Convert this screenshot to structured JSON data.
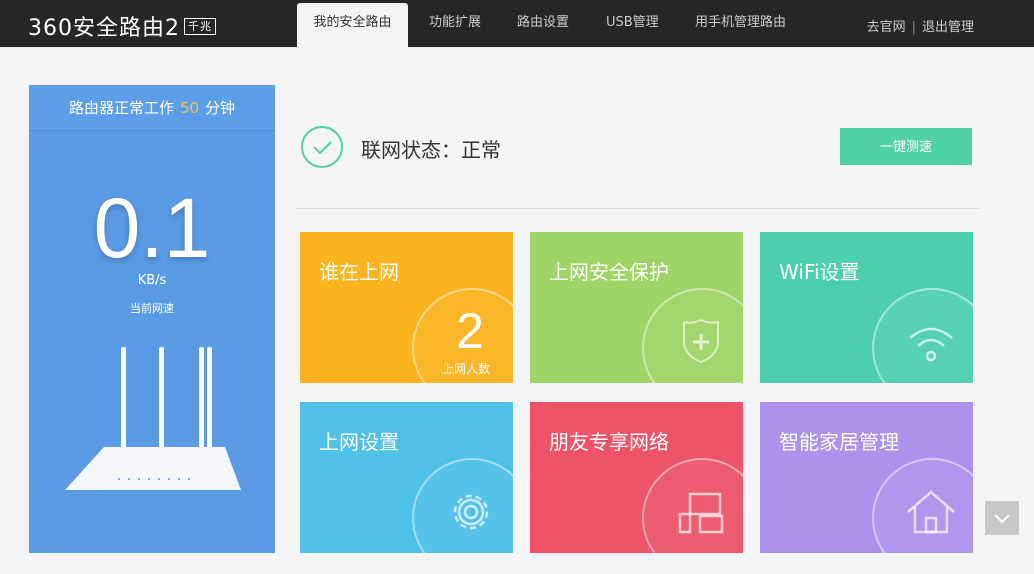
{
  "header": {
    "logo": "360安全路由2",
    "logo_badge": "千兆",
    "tabs": [
      "我的安全路由",
      "功能扩展",
      "路由设置",
      "USB管理",
      "用手机管理路由"
    ],
    "links": [
      "去官网",
      "退出管理"
    ]
  },
  "sidebar": {
    "uptime_prefix": "路由器正常工作",
    "uptime_value": "50",
    "uptime_suffix": "分钟",
    "speed": "0.1",
    "unit": "KB/s",
    "caption": "当前网速"
  },
  "status": {
    "text": "联网状态：正常",
    "button": "一键测速"
  },
  "tiles": [
    {
      "title": "谁在上网",
      "count": "2",
      "count_label": "上网人数",
      "color": "#fbb41f"
    },
    {
      "title": "上网安全保护",
      "icon": "shield-plus-icon",
      "color": "#9fd466"
    },
    {
      "title": "WiFi设置",
      "icon": "wifi-icon",
      "color": "#4dcfae"
    },
    {
      "title": "上网设置",
      "icon": "gear-icon",
      "color": "#4fc0e8"
    },
    {
      "title": "朋友专享网络",
      "icon": "devices-icon",
      "color": "#ee5468"
    },
    {
      "title": "智能家居管理",
      "icon": "home-icon",
      "color": "#ac92ec"
    }
  ]
}
